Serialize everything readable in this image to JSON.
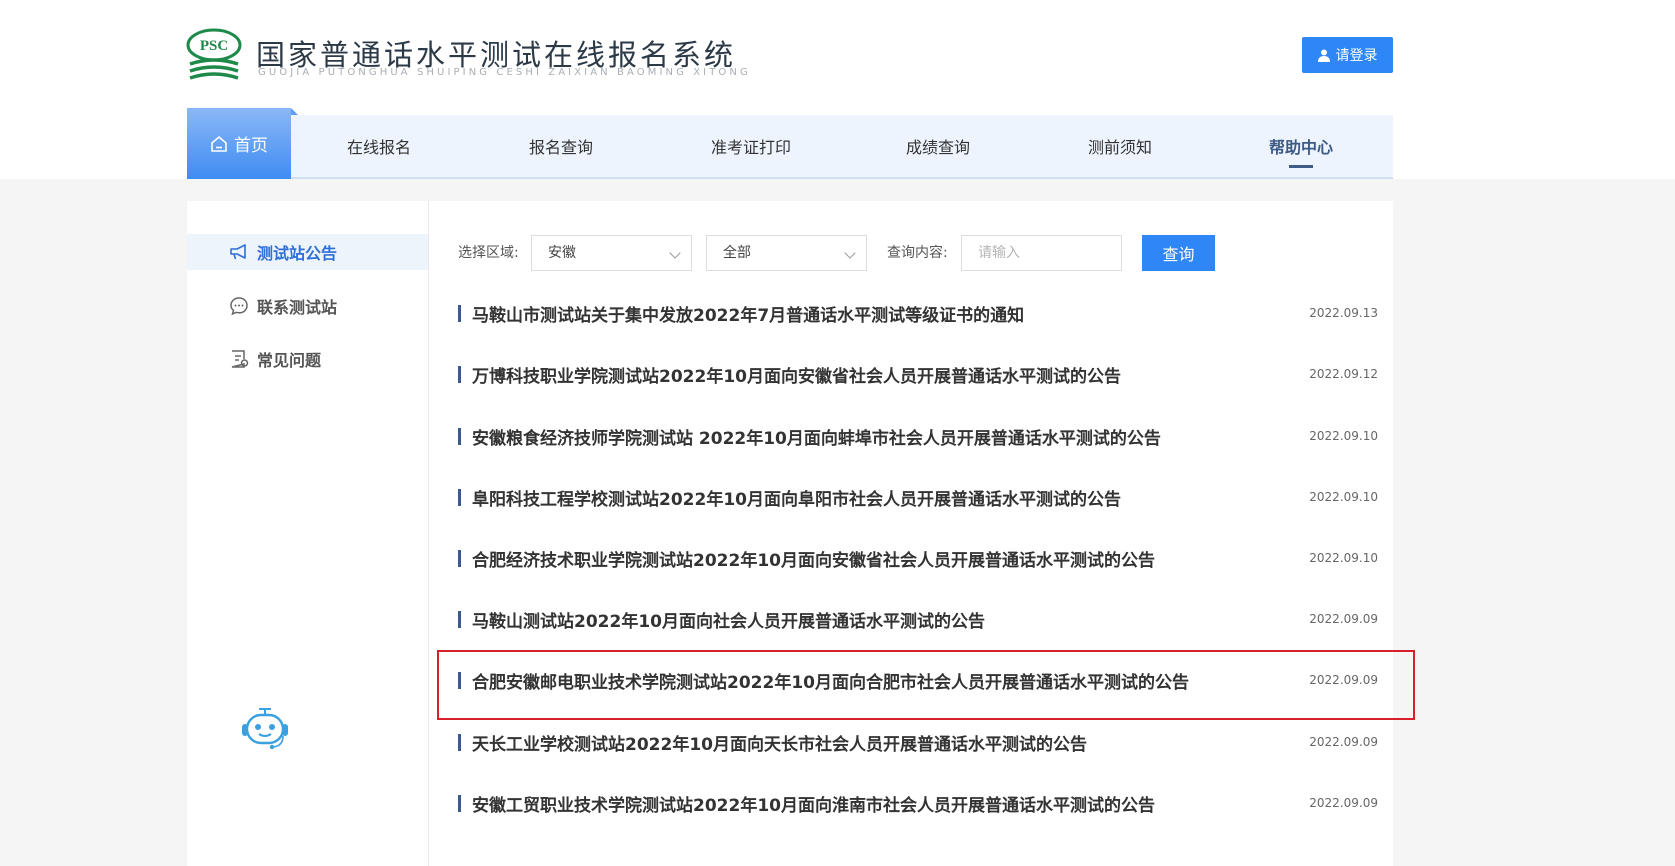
{
  "site": {
    "logo_text": "PSC",
    "title": "国家普通话水平测试在线报名系统",
    "subtitle": "GUOJIA PUTONGHUA SHUIPING CESHI ZAIXIAN BAOMING XITONG",
    "login_label": "请登录",
    "accent_color": "#2f86f6"
  },
  "nav": {
    "home": "首页",
    "items": [
      "在线报名",
      "报名查询",
      "准考证打印",
      "成绩查询",
      "测前须知",
      "帮助中心"
    ],
    "active": "帮助中心"
  },
  "sidebar": {
    "items": [
      {
        "label": "测试站公告",
        "icon": "megaphone-icon",
        "active": true
      },
      {
        "label": "联系测试站",
        "icon": "chat-icon",
        "active": false
      },
      {
        "label": "常见问题",
        "icon": "faq-document-icon",
        "active": false
      }
    ],
    "assistant_icon": "robot-assistant-icon"
  },
  "filters": {
    "region_label": "选择区域:",
    "region_value": "安徽",
    "scope_value": "全部",
    "query_label": "查询内容:",
    "query_placeholder": "请输入",
    "query_button": "查询"
  },
  "announcements": [
    {
      "title": "马鞍山市测试站关于集中发放2022年7月普通话水平测试等级证书的通知",
      "date": "2022.09.13"
    },
    {
      "title": "万博科技职业学院测试站2022年10月面向安徽省社会人员开展普通话水平测试的公告",
      "date": "2022.09.12"
    },
    {
      "title": "安徽粮食经济技师学院测试站 2022年10月面向蚌埠市社会人员开展普通话水平测试的公告",
      "date": "2022.09.10"
    },
    {
      "title": "阜阳科技工程学校测试站2022年10月面向阜阳市社会人员开展普通话水平测试的公告",
      "date": "2022.09.10"
    },
    {
      "title": "合肥经济技术职业学院测试站2022年10月面向安徽省社会人员开展普通话水平测试的公告",
      "date": "2022.09.10"
    },
    {
      "title": "马鞍山测试站2022年10月面向社会人员开展普通话水平测试的公告",
      "date": "2022.09.09"
    },
    {
      "title": "合肥安徽邮电职业技术学院测试站2022年10月面向合肥市社会人员开展普通话水平测试的公告",
      "date": "2022.09.09",
      "highlighted": true
    },
    {
      "title": "天长工业学校测试站2022年10月面向天长市社会人员开展普通话水平测试的公告",
      "date": "2022.09.09"
    },
    {
      "title": "安徽工贸职业技术学院测试站2022年10月面向淮南市社会人员开展普通话水平测试的公告",
      "date": "2022.09.09"
    }
  ],
  "highlight_color": "#d8202c"
}
